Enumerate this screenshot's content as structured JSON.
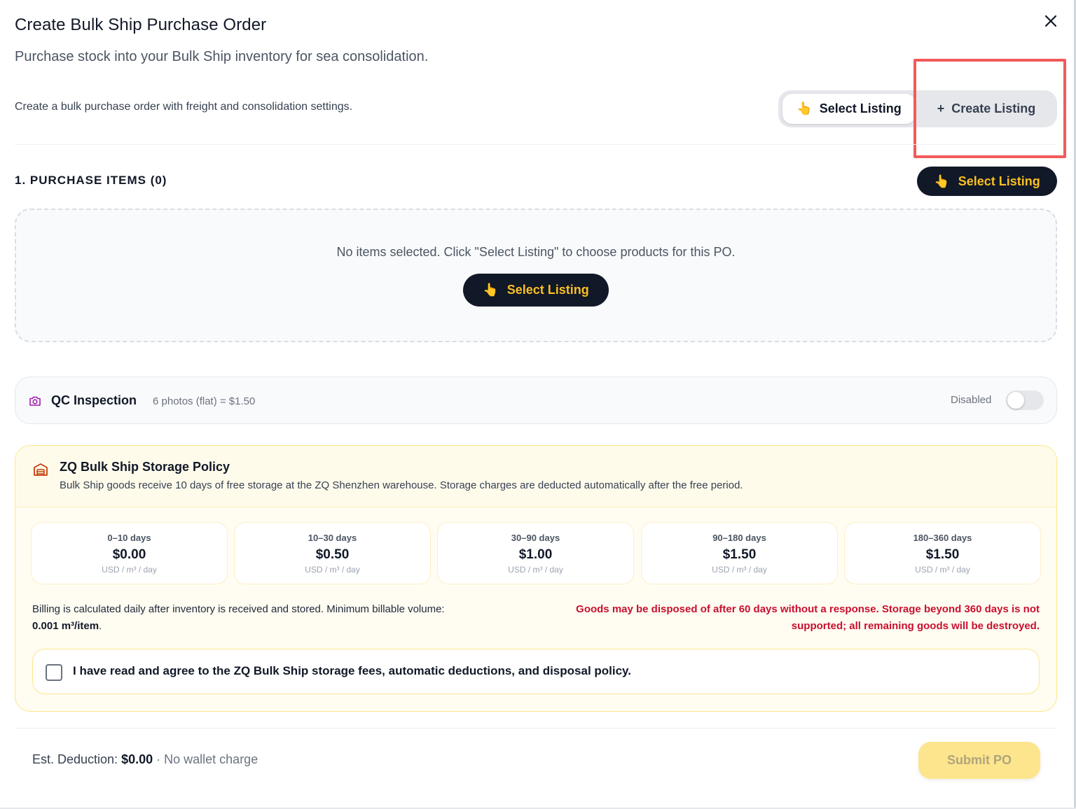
{
  "modal": {
    "title": "Create Bulk Ship Purchase Order",
    "subtitle": "Purchase stock into your Bulk Ship inventory for sea consolidation.",
    "description": "Create a bulk purchase order with freight and consolidation settings.",
    "close_icon": "close-icon"
  },
  "mode_switch": {
    "select_label": "Select Listing",
    "select_icon": "👆",
    "create_label": "Create Listing",
    "create_icon": "+"
  },
  "purchase_items": {
    "section_title": "1. PURCHASE ITEMS (0)",
    "select_button_label": "Select Listing",
    "select_button_icon": "👆",
    "empty_text": "No items selected. Click \"Select Listing\" to choose products for this PO.",
    "empty_button_label": "Select Listing",
    "empty_button_icon": "👆"
  },
  "qc": {
    "icon": "camera-icon",
    "title": "QC Inspection",
    "subtitle": "6 photos (flat) = $1.50",
    "status": "Disabled",
    "enabled": false
  },
  "storage_policy": {
    "icon": "warehouse-icon",
    "title": "ZQ Bulk Ship Storage Policy",
    "subtitle": "Bulk Ship goods receive 10 days of free storage at the ZQ Shenzhen warehouse. Storage charges are deducted automatically after the free period.",
    "tiers": [
      {
        "range": "0–10 days",
        "price": "$0.00",
        "unit": "USD / m³ / day"
      },
      {
        "range": "10–30 days",
        "price": "$0.50",
        "unit": "USD / m³ / day"
      },
      {
        "range": "30–90 days",
        "price": "$1.00",
        "unit": "USD / m³ / day"
      },
      {
        "range": "90–180 days",
        "price": "$1.50",
        "unit": "USD / m³ / day"
      },
      {
        "range": "180–360 days",
        "price": "$1.50",
        "unit": "USD / m³ / day"
      }
    ],
    "billing_text": "Billing is calculated daily after inventory is received and stored. Minimum billable volume:",
    "billing_min": "0.001 m³/item",
    "billing_end": ".",
    "warning_text": "Goods may be disposed of after 60 days without a response. Storage beyond 360 days is not supported; all remaining goods will be destroyed.",
    "agree_text": "I have read and agree to the ZQ Bulk Ship storage fees, automatic deductions, and disposal policy.",
    "agreed": false
  },
  "footer": {
    "deduction_label": "Est. Deduction:",
    "deduction_value": "$0.00",
    "deduction_note": "· No wallet charge",
    "submit_label": "Submit PO"
  },
  "colors": {
    "dark_button": "#111827",
    "accent_yellow": "#fbbf24",
    "warning_red": "#c8102e",
    "highlight": "#f25a5a",
    "qc_icon": "#a21caf",
    "policy_icon": "#c2410c"
  }
}
